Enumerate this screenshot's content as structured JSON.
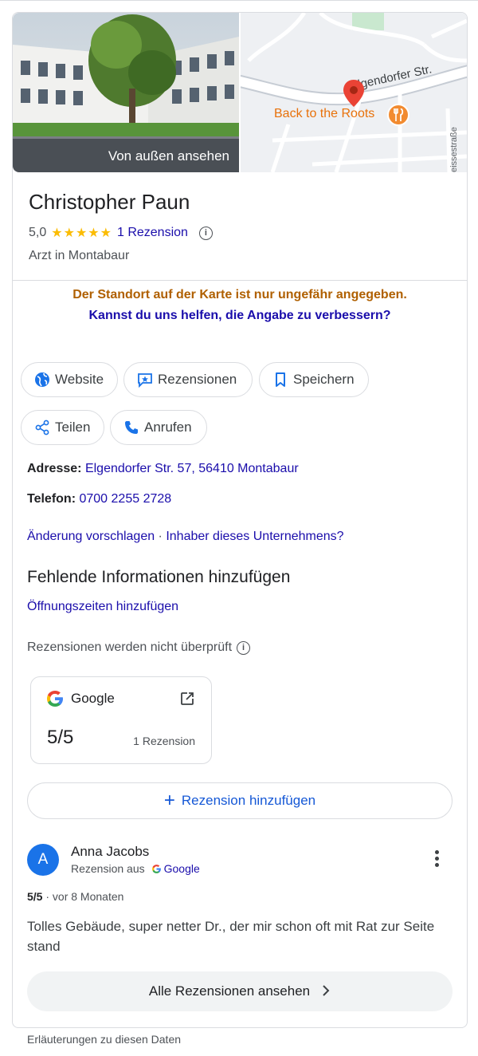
{
  "hero": {
    "photo_label": "Von außen ansehen",
    "map_street": "Elgendorfer Str.",
    "map_poi": "Back to the Roots",
    "map_side_street": "eissestraße"
  },
  "business": {
    "name": "Christopher Paun",
    "rating": "5,0",
    "stars": "★★★★★",
    "reviews_link": "1 Rezension",
    "category": "Arzt in Montabaur"
  },
  "notice": {
    "warning": "Der Standort auf der Karte ist nur ungefähr angegeben.",
    "help_link": "Kannst du uns helfen, die Angabe zu verbessern?"
  },
  "actions": {
    "website": "Website",
    "reviews": "Rezensionen",
    "save": "Speichern",
    "share": "Teilen",
    "call": "Anrufen"
  },
  "details": {
    "address_label": "Adresse:",
    "address_value": "Elgendorfer Str. 57, 56410 Montabaur",
    "phone_label": "Telefon:",
    "phone_value": "0700 2255 2728",
    "suggest_edit": "Änderung vorschlagen",
    "separator": " · ",
    "owner_link": "Inhaber dieses Unternehmens?"
  },
  "missing": {
    "title": "Fehlende Informationen hinzufügen",
    "hours_link": "Öffnungszeiten hinzufügen"
  },
  "reviews": {
    "disclaimer": "Rezensionen werden nicht überprüft",
    "source_name": "Google",
    "source_score": "5/5",
    "source_count": "1 Rezension",
    "add_review": "Rezension hinzufügen",
    "all_reviews": "Alle Rezensionen ansehen"
  },
  "review": {
    "avatar_letter": "A",
    "author": "Anna Jacobs",
    "from_label": "Rezension aus",
    "from_source": "Google",
    "score": "5/5",
    "meta_sep": " · ",
    "age": "vor 8 Monaten",
    "text": "Tolles Gebäude, super netter Dr., der mir schon oft mit Rat zur Seite stand"
  },
  "footer": {
    "note": "Erläuterungen zu diesen Daten"
  },
  "colors": {
    "link": "#1a0dab",
    "warning": "#b06000",
    "star": "#fbbc04",
    "accent_blue": "#1a73e8"
  }
}
